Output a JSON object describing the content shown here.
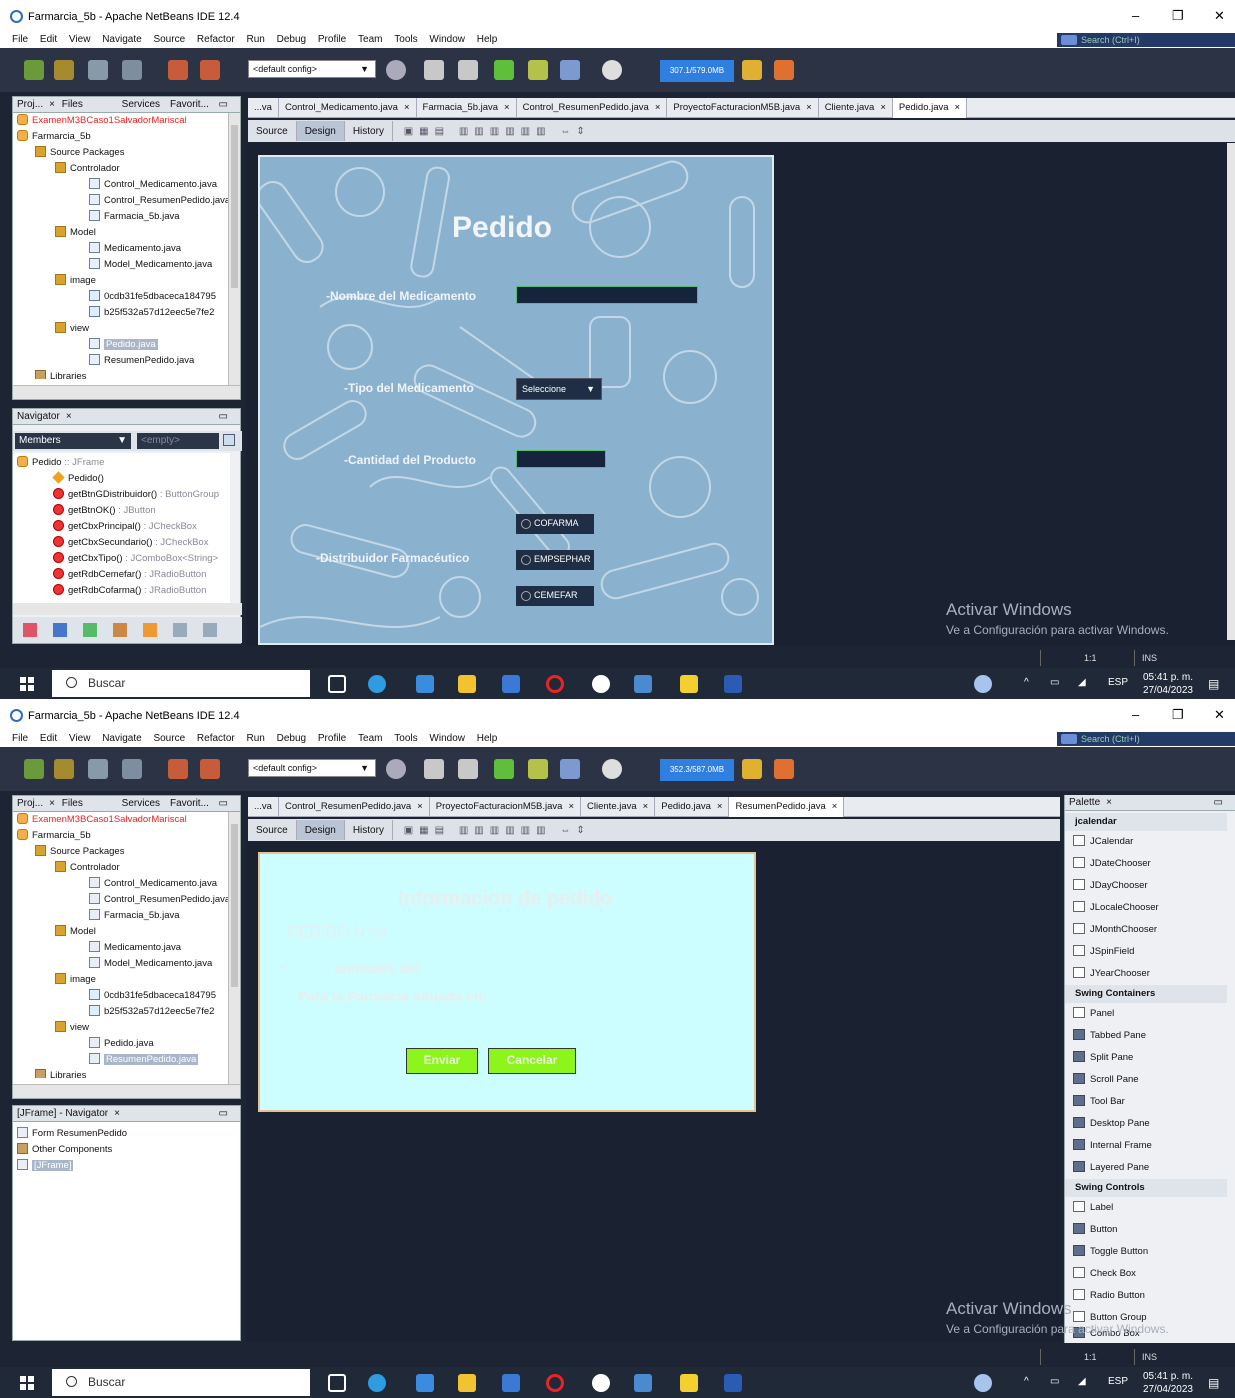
{
  "window_title": "Farmarcia_5b - Apache NetBeans IDE 12.4",
  "menu": [
    "File",
    "Edit",
    "View",
    "Navigate",
    "Source",
    "Refactor",
    "Run",
    "Debug",
    "Profile",
    "Team",
    "Tools",
    "Window",
    "Help"
  ],
  "search_placeholder": "Search (Ctrl+I)",
  "config": "<default config>",
  "window_controls": {
    "minimize": "–",
    "maximize": "❐",
    "close": "✕"
  },
  "project_panel": {
    "tabs": [
      "Proj...",
      "Files",
      "Services",
      "Favorit..."
    ],
    "items": [
      "ExamenM3BCaso1SalvadorMariscal",
      "Farmarcia_5b",
      "Source Packages",
      "Controlador",
      "Control_Medicamento.java",
      "Control_ResumenPedido.java",
      "Farmacia_5b.java",
      "Model",
      "Medicamento.java",
      "Model_Medicamento.java",
      "image",
      "0cdb31fe5dbaceca184795",
      "b25f532a57d12eec5e7fe2",
      "view",
      "Pedido.java",
      "ResumenPedido.java",
      "Libraries"
    ]
  },
  "shot1": {
    "memory": "307.1/579.0MB",
    "editor_tabs": [
      "...va",
      "Control_Medicamento.java",
      "Farmacia_5b.java",
      "Control_ResumenPedido.java",
      "ProyectoFacturacionM5B.java",
      "Cliente.java",
      "Pedido.java"
    ],
    "view_tabs": [
      "Source",
      "Design",
      "History"
    ],
    "navigator": {
      "title": "Navigator",
      "members_label": "Members",
      "filter_placeholder": "<empty>",
      "root": "Pedido",
      "root_type": ":: JFrame",
      "members": [
        {
          "name": "Pedido()",
          "type": ""
        },
        {
          "name": "getBtnGDistribuidor()",
          "type": ": ButtonGroup"
        },
        {
          "name": "getBtnOK()",
          "type": ": JButton"
        },
        {
          "name": "getCbxPrincipal()",
          "type": ": JCheckBox"
        },
        {
          "name": "getCbxSecundario()",
          "type": ": JCheckBox"
        },
        {
          "name": "getCbxTipo()",
          "type": ": JComboBox<String>"
        },
        {
          "name": "getRdbCemefar()",
          "type": ": JRadioButton"
        },
        {
          "name": "getRdbCofarma()",
          "type": ": JRadioButton"
        }
      ]
    },
    "form": {
      "title": "Pedido",
      "label_nombre": "-Nombre del Medicamento",
      "label_tipo": "-Tipo del Medicamento",
      "tipo_selected": "Seleccione",
      "label_cantidad": "-Cantidad del Producto",
      "label_distribuidor": "-Distribuidor Farmacéutico",
      "radio_cofarma": "COFARMA",
      "radio_empsephar": "EMPSEPHAR",
      "radio_cemefar": "CEMEFAR"
    },
    "status": {
      "position": "1:1",
      "mode": "INS"
    },
    "clock": {
      "time": "05:41 p. m.",
      "date": "27/04/2023"
    }
  },
  "shot2": {
    "memory": "352.3/587.0MB",
    "editor_tabs": [
      "...va",
      "Control_ResumenPedido.java",
      "ProyectoFacturacionM5B.java",
      "Cliente.java",
      "Pedido.java",
      "ResumenPedido.java"
    ],
    "view_tabs": [
      "Source",
      "Design",
      "History"
    ],
    "navigator": {
      "title": "[JFrame] - Navigator",
      "items": [
        "Form ResumenPedido",
        "Other Components",
        "[JFrame]"
      ]
    },
    "form": {
      "title": "Informacion de pedido",
      "pedido_no": "PEDIDO N°",
      "pedido_num": "00",
      "bullet": "•",
      "unidades": "unidades del",
      "farmacia": "Para la Farmacia situada en:",
      "btn_enviar": "Enviar",
      "btn_cancelar": "Cancelar"
    },
    "palette": {
      "title": "Palette",
      "groups": [
        {
          "name": "jcalendar",
          "items": [
            "JCalendar",
            "JDateChooser",
            "JDayChooser",
            "JLocaleChooser",
            "JMonthChooser",
            "JSpinField",
            "JYearChooser"
          ]
        },
        {
          "name": "Swing Containers",
          "items": [
            "Panel",
            "Tabbed Pane",
            "Split Pane",
            "Scroll Pane",
            "Tool Bar",
            "Desktop Pane",
            "Internal Frame",
            "Layered Pane"
          ]
        },
        {
          "name": "Swing Controls",
          "items": [
            "Label",
            "Button",
            "Toggle Button",
            "Check Box",
            "Radio Button",
            "Button Group",
            "Combo Box"
          ]
        }
      ]
    },
    "status": {
      "position": "1:1",
      "mode": "INS"
    },
    "clock": {
      "time": "05:41 p. m.",
      "date": "27/04/2023"
    }
  },
  "watermark": {
    "title": "Activar Windows",
    "subtitle": "Ve a Configuración para activar Windows."
  },
  "taskbar": {
    "search": "Buscar",
    "lang": "ESP"
  },
  "colors": {
    "form1_bg": "#8ab2cf",
    "form2_bg": "#ccfeff",
    "button_green": "#8df51c",
    "ide_bg": "#1d2535",
    "memory_bar": "#2f7fe0"
  }
}
